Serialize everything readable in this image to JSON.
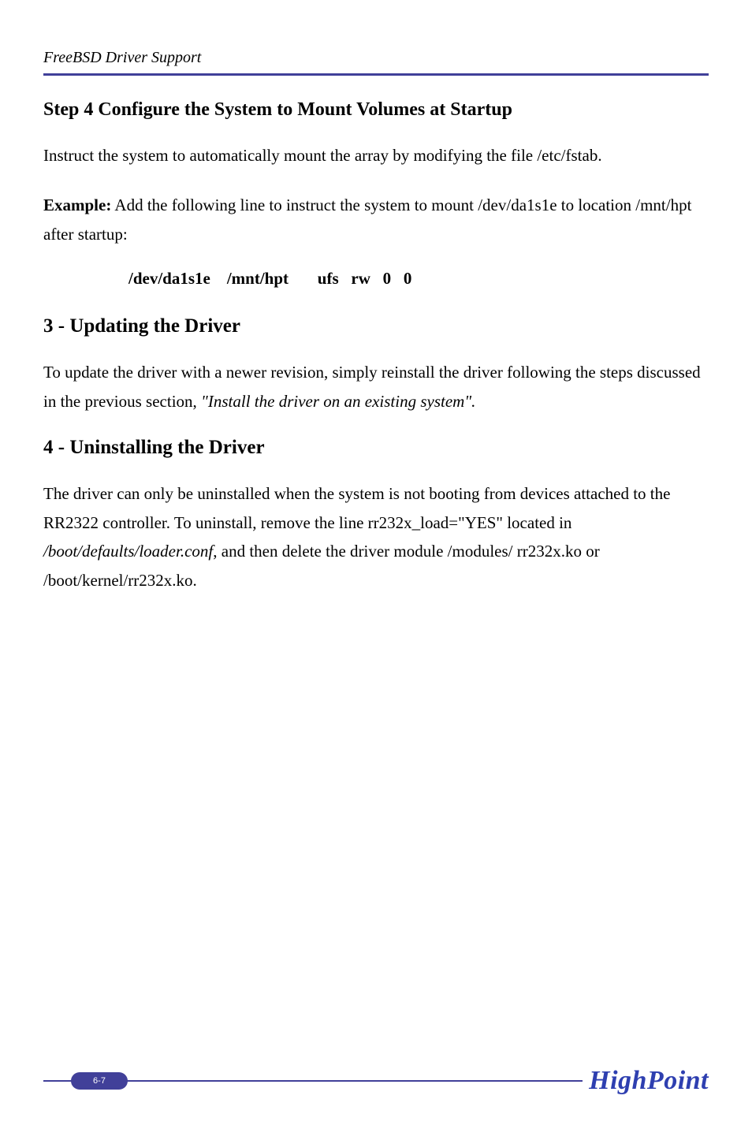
{
  "running_head": "FreeBSD Driver Support",
  "step4": {
    "title": "Step 4 Configure the System to Mount Volumes at Startup",
    "p1": "Instruct the system to automatically mount the array by modifying the file /etc/fstab.",
    "ex_label": "Example:",
    "ex_rest": " Add the following line to instruct the system to mount /dev/da1s1e to location /mnt/hpt after startup:",
    "code": "/dev/da1s1e    /mnt/hpt       ufs   rw   0   0"
  },
  "sec3": {
    "title": "3 - Updating the Driver",
    "p1a": "To update the driver with a newer revision, simply reinstall the driver following the steps discussed in the previous section, ",
    "p1b": "\"Install the driver on an existing system\"."
  },
  "sec4": {
    "title": "4 - Uninstalling the Driver",
    "p1a": "The driver can only be uninstalled when the system is not booting from devices attached to the RR2322 controller. To uninstall, remove the line rr232x_load=\"YES\" located in ",
    "p1b": "/boot/defaults/loader.conf",
    "p1c": ", and then delete the driver module /modules/ rr232x.ko or /boot/kernel/rr232x.ko."
  },
  "footer": {
    "page": "6-7",
    "brand": "HighPoint"
  }
}
